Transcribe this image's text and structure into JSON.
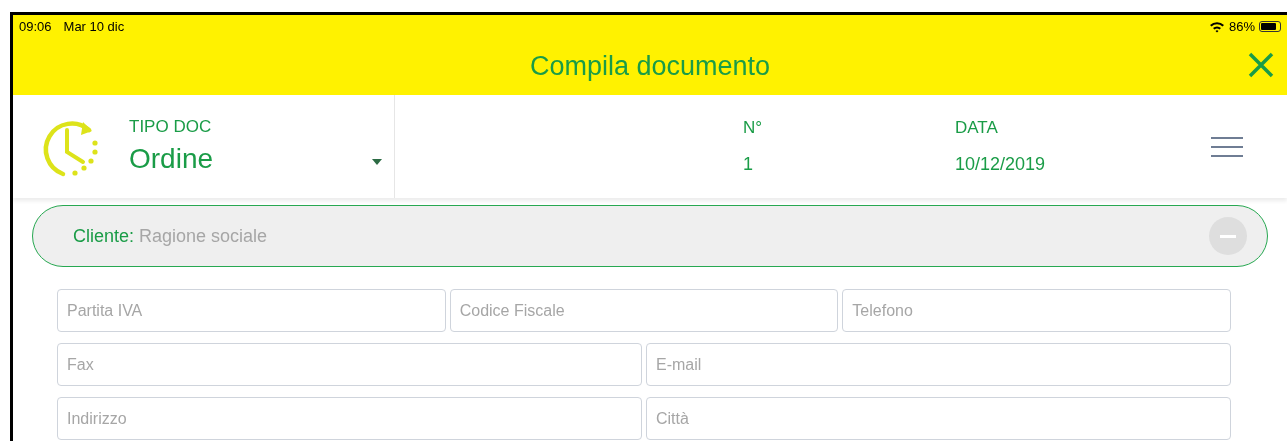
{
  "status_bar": {
    "time": "09:06",
    "date": "Mar 10 dic",
    "battery": "86%"
  },
  "title": "Compila documento",
  "header": {
    "doc_type_label": "TIPO DOC",
    "doc_type": "Ordine",
    "number_label": "N°",
    "number": "1",
    "date_label": "DATA",
    "date": "10/12/2019"
  },
  "client": {
    "label": "Cliente:",
    "placeholder": "Ragione sociale"
  },
  "field_rows": [
    {
      "fields": [
        {
          "placeholder": "Partita IVA"
        },
        {
          "placeholder": "Codice Fiscale"
        },
        {
          "placeholder": "Telefono"
        }
      ]
    },
    {
      "fields": [
        {
          "placeholder": "Fax"
        },
        {
          "placeholder": "E-mail"
        }
      ]
    },
    {
      "fields": [
        {
          "placeholder": "Indirizzo"
        },
        {
          "placeholder": "Città"
        }
      ]
    }
  ]
}
